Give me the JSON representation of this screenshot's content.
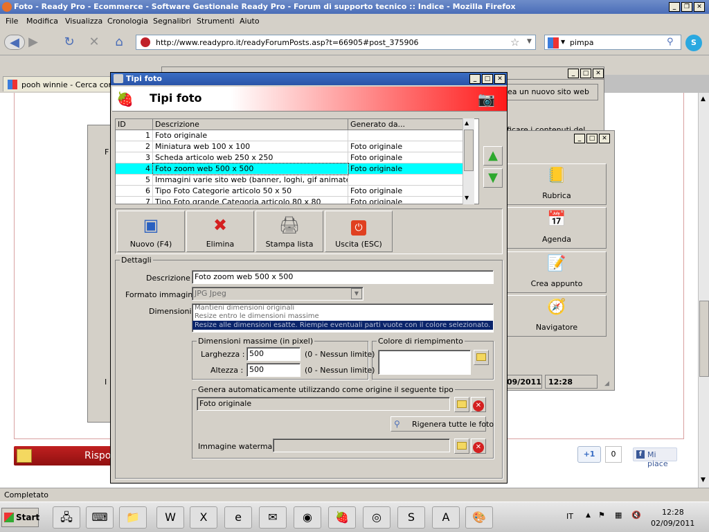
{
  "browser": {
    "title": "Foto - Ready Pro - Ecommerce - Software Gestionale Ready Pro - Forum di supporto tecnico :: Indice - Mozilla Firefox",
    "menu": [
      "File",
      "Modifica",
      "Visualizza",
      "Cronologia",
      "Segnalibri",
      "Strumenti",
      "Aiuto"
    ],
    "url": "http://www.readypro.it/readyForumPosts.asp?t=66905#post_375906",
    "search_value": "pimpa",
    "tab_label": "pooh winnie - Cerca con G",
    "status": "Completato",
    "page_buttons": {
      "respond": "Rispo",
      "plus_one": "+1",
      "plus_count": "0",
      "like": "Mi piace"
    }
  },
  "bg_window": {
    "create_site_button": "ea un nuovo sito web",
    "partial_text": "ficare i contenuti del",
    "buttons": [
      {
        "label": "Rubrica",
        "icon": "address-book-icon"
      },
      {
        "label": "Agenda",
        "icon": "calendar-clock-icon"
      },
      {
        "label": "Crea appunto",
        "icon": "note-icon"
      },
      {
        "label": "Navigatore",
        "icon": "compass-icon"
      }
    ],
    "status_date": "09/2011",
    "status_time": "12:28",
    "side_label": "F",
    "side_label2": "I"
  },
  "dialog": {
    "window_title": "Tipi foto",
    "banner_title": "Tipi foto",
    "columns": [
      "ID",
      "Descrizione",
      "Generato da..."
    ],
    "rows": [
      {
        "id": "1",
        "descrizione": "Foto originale",
        "generato": ""
      },
      {
        "id": "2",
        "descrizione": "Miniatura web 100 x 100",
        "generato": "Foto originale"
      },
      {
        "id": "3",
        "descrizione": "Scheda articolo web 250 x 250",
        "generato": "Foto originale"
      },
      {
        "id": "4",
        "descrizione": "Foto zoom web 500 x 500",
        "generato": "Foto originale"
      },
      {
        "id": "5",
        "descrizione": "Immagini varie sito web (banner, loghi, gif animate, flash, ...",
        "generato": ""
      },
      {
        "id": "6",
        "descrizione": "Tipo Foto Categorie articolo 50 x 50",
        "generato": "Foto originale"
      },
      {
        "id": "7",
        "descrizione": "Tipo Foto grande Categoria articolo 80 x 80",
        "generato": "Foto originale"
      }
    ],
    "selected_row_index": 3,
    "toolbar": {
      "new": "Nuovo (F4)",
      "delete": "Elimina",
      "print": "Stampa lista",
      "exit": "Uscita (ESC)"
    },
    "details": {
      "group_title": "Dettagli",
      "descrizione_label": "Descrizione :",
      "descrizione_value": "Foto zoom web 500 x 500",
      "formato_label": "Formato immagine :",
      "formato_value": "JPG Jpeg",
      "dimensioni_label": "Dimensioni :",
      "dimensioni_options": [
        "Mantieni dimensioni originali",
        "Resize entro le dimensioni massime",
        "Resize alle dimensioni esatte. Riempie eventuali parti vuote con il colore selezionato."
      ],
      "dimensioni_selected": 2,
      "max_group_title": "Dimensioni massime (in pixel)",
      "larghezza_label": "Larghezza :",
      "larghezza_value": "500",
      "altezza_label": "Altezza :",
      "altezza_value": "500",
      "limit_hint": "(0 - Nessun limite)",
      "colore_group_title": "Colore di riempimento",
      "genera_group_title": "Genera automaticamente utilizzando come origine il seguente tipo",
      "genera_value": "Foto originale",
      "rigenera_button": "Rigenera tutte le foto",
      "watermark_label": "Immagine watermark :",
      "watermark_value": ""
    }
  },
  "taskbar": {
    "start": "Start",
    "language": "IT",
    "time": "12:28",
    "date": "02/09/2011"
  },
  "colors": {
    "selected_row": "#00ffff",
    "banner_red": "#ff1a1a",
    "list_selection": "#0a246a"
  }
}
